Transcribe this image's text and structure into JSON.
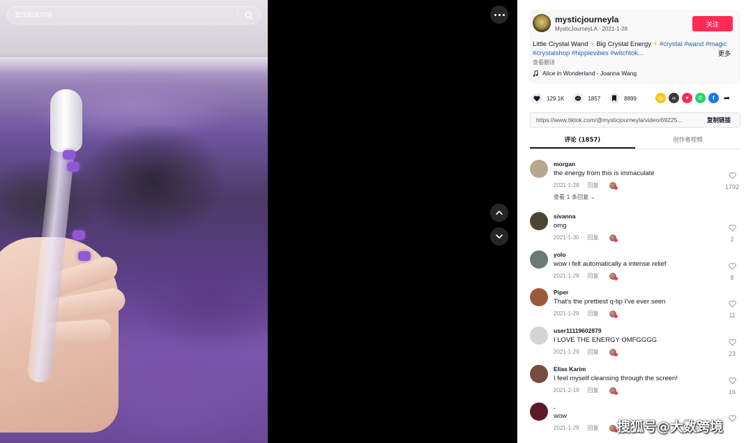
{
  "search": {
    "placeholder": "查找相关内容"
  },
  "author": {
    "username": "mysticjourneyla",
    "display_name": "MysticJourneyLA",
    "date": "2021-1-28",
    "follow_label": "关注"
  },
  "description": {
    "text_part1": "Little Crystal Wand ",
    "text_part2": " Big Crystal Energy ",
    "bolt": "⚡",
    "tags": [
      "#crystal",
      "#wand",
      "#magic",
      "#crystalshop",
      "#hippievibes",
      "#witchtok..."
    ],
    "more_label": "更多",
    "translate_label": "查看翻译"
  },
  "music": {
    "title": "Alice in Wonderland - Joanna Wang"
  },
  "stats": {
    "likes": "129.1K",
    "comments": "1857",
    "saves": "8899"
  },
  "share_icons": [
    "tiktok-coin-icon",
    "embed-icon",
    "send-icon",
    "whatsapp-icon",
    "facebook-icon",
    "forward-icon"
  ],
  "link": {
    "url": "https://www.tiktok.com/@mysticjourneyla/video/69225...",
    "copy_label": "复制链接"
  },
  "tabs": {
    "comments": "评论 (1857)",
    "creator_videos": "创作者视频"
  },
  "comments": [
    {
      "user": "morgan",
      "text": "the energy from this is immaculate",
      "date": "2021-1-28",
      "reply": "回复",
      "likes": "1792",
      "view_replies": "查看 1 条回复",
      "avatar_color": "#b9a68e"
    },
    {
      "user": "sivanna",
      "text": "omg",
      "date": "2021-1-30",
      "reply": "回复",
      "likes": "2",
      "avatar_color": "#4a4533"
    },
    {
      "user": "yolo",
      "text": "wow i felt automatically a intense relief",
      "date": "2021-1-28",
      "reply": "回复",
      "likes": "8",
      "avatar_color": "#6b7a72"
    },
    {
      "user": "Piper",
      "text": "That's the prettiest q-tip I've ever seen",
      "date": "2021-1-29",
      "reply": "回复",
      "likes": "11",
      "avatar_color": "#9c5a3c"
    },
    {
      "user": "user11119602879",
      "text": "I LOVE THE ENERGY OMFGGGG",
      "date": "2021-1-29",
      "reply": "回复",
      "likes": "23",
      "avatar_color": "#d4d4d6"
    },
    {
      "user": "Elias Karim",
      "text": "I feel myself cleansing through the screen!",
      "date": "2021-2-19",
      "reply": "回复",
      "likes": "16",
      "avatar_color": "#7a4b40"
    },
    {
      "user": ".",
      "text": "wow",
      "date": "2021-1-29",
      "reply": "回复",
      "likes": "",
      "avatar_color": "#5a1a2a"
    }
  ],
  "watermark": "搜狐号@大数跨境"
}
